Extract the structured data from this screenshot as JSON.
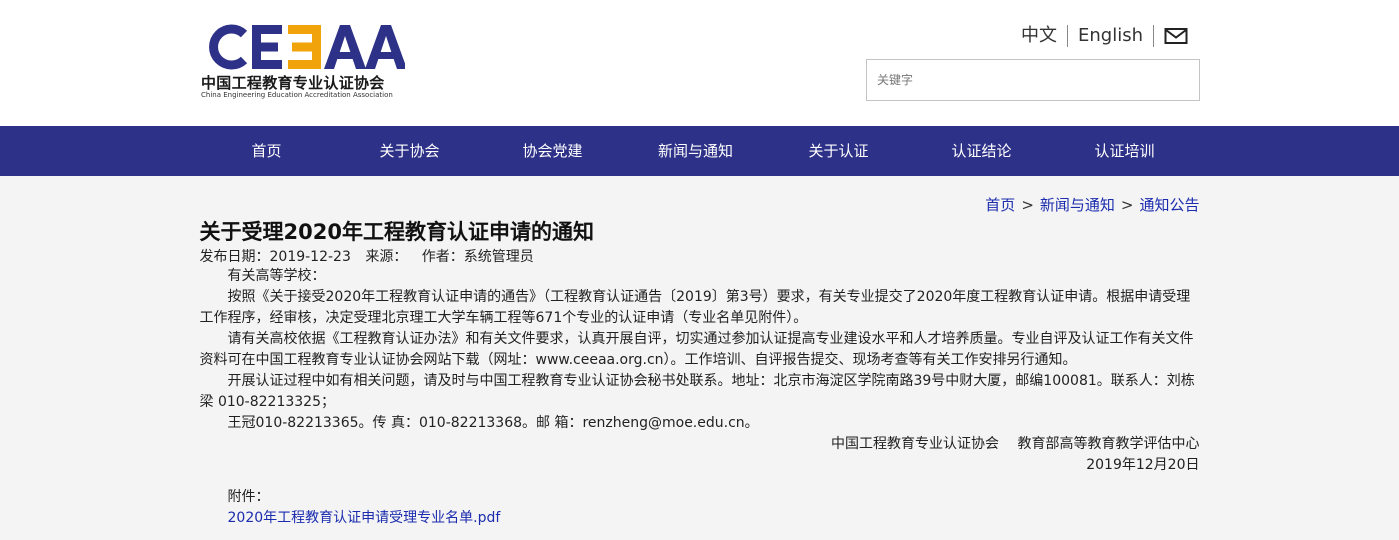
{
  "logo": {
    "mark": "CEEAA",
    "cn_name": "中国工程教育专业认证协会",
    "en_name": "China Engineering Education Accreditation Association",
    "brand_color": "#2e3188",
    "accent_color": "#f0a30a"
  },
  "lang": {
    "zh": "中文",
    "en": "English",
    "mail_icon": "mail-icon"
  },
  "search": {
    "placeholder": "关键字",
    "value": ""
  },
  "nav": {
    "items": [
      "首页",
      "关于协会",
      "协会党建",
      "新闻与通知",
      "关于认证",
      "认证结论",
      "认证培训"
    ],
    "bg_color": "#2e3188"
  },
  "breadcrumb": {
    "items": [
      "首页",
      "新闻与通知",
      "通知公告"
    ],
    "separator": ">"
  },
  "article": {
    "title": "关于受理2020年工程教育认证申请的通知",
    "date_label": "发布日期：2019-12-23",
    "source_label": "来源：",
    "author_label": "作者：系统管理员",
    "paragraphs": [
      "有关高等学校：",
      "按照《关于接受2020年工程教育认证申请的通告》（工程教育认证通告〔2019〕第3号）要求，有关专业提交了2020年度工程教育认证申请。根据申请受理工作程序，经审核，决定受理北京理工大学车辆工程等671个专业的认证申请（专业名单见附件）。",
      "请有关高校依据《工程教育认证办法》和有关文件要求，认真开展自评，切实通过参加认证提高专业建设水平和人才培养质量。专业自评及认证工作有关文件资料可在中国工程教育专业认证协会网站下载（网址：www.ceeaa.org.cn）。工作培训、自评报告提交、现场考查等有关工作安排另行通知。",
      "开展认证过程中如有相关问题，请及时与中国工程教育专业认证协会秘书处联系。地址：北京市海淀区学院南路39号中财大厦，邮编100081。联系人：刘栋梁 010-82213325；",
      "王冠010-82213365。传 真：010-82213368。邮 箱：renzheng@moe.edu.cn。"
    ],
    "signature": "中国工程教育专业认证协会　 教育部高等教育教学评估中心",
    "sign_date": "2019年12月20日",
    "attachment_label": "附件：",
    "attachment_link": "2020年工程教育认证申请受理专业名单.pdf",
    "link_color": "#1b2cae"
  }
}
